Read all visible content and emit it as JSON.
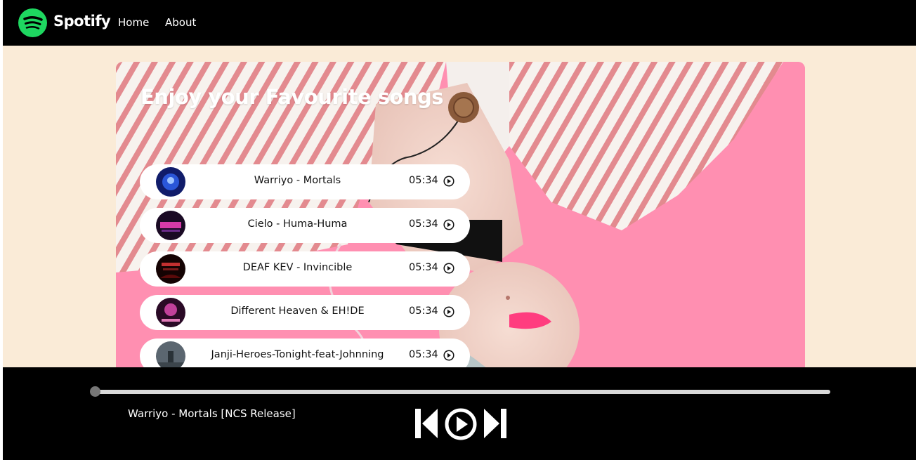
{
  "nav": {
    "brand": "Spotify",
    "links": [
      "Home",
      "About"
    ]
  },
  "hero": {
    "title": "Enjoy your Favourite songs"
  },
  "songs": [
    {
      "name": "Warriyo - Mortals",
      "duration": "05:34",
      "cover_color": "#1a2a8a"
    },
    {
      "name": "Cielo - Huma-Huma",
      "duration": "05:34",
      "cover_color": "#3a1030"
    },
    {
      "name": "DEAF KEV - Invincible",
      "duration": "05:34",
      "cover_color": "#2a0505"
    },
    {
      "name": "Different Heaven & EH!DE",
      "duration": "05:34",
      "cover_color": "#5a1a4a"
    },
    {
      "name": "Janji-Heroes-Tonight-feat-Johnning",
      "duration": "05:34",
      "cover_color": "#4a5560"
    }
  ],
  "player": {
    "now_playing": "Warriyo - Mortals [NCS Release]",
    "progress": 0,
    "controls": [
      "previous-icon",
      "play-icon",
      "next-icon"
    ]
  },
  "colors": {
    "accent": "#1ed760",
    "page_bg": "#faebd7",
    "bar_bg": "#000000"
  }
}
